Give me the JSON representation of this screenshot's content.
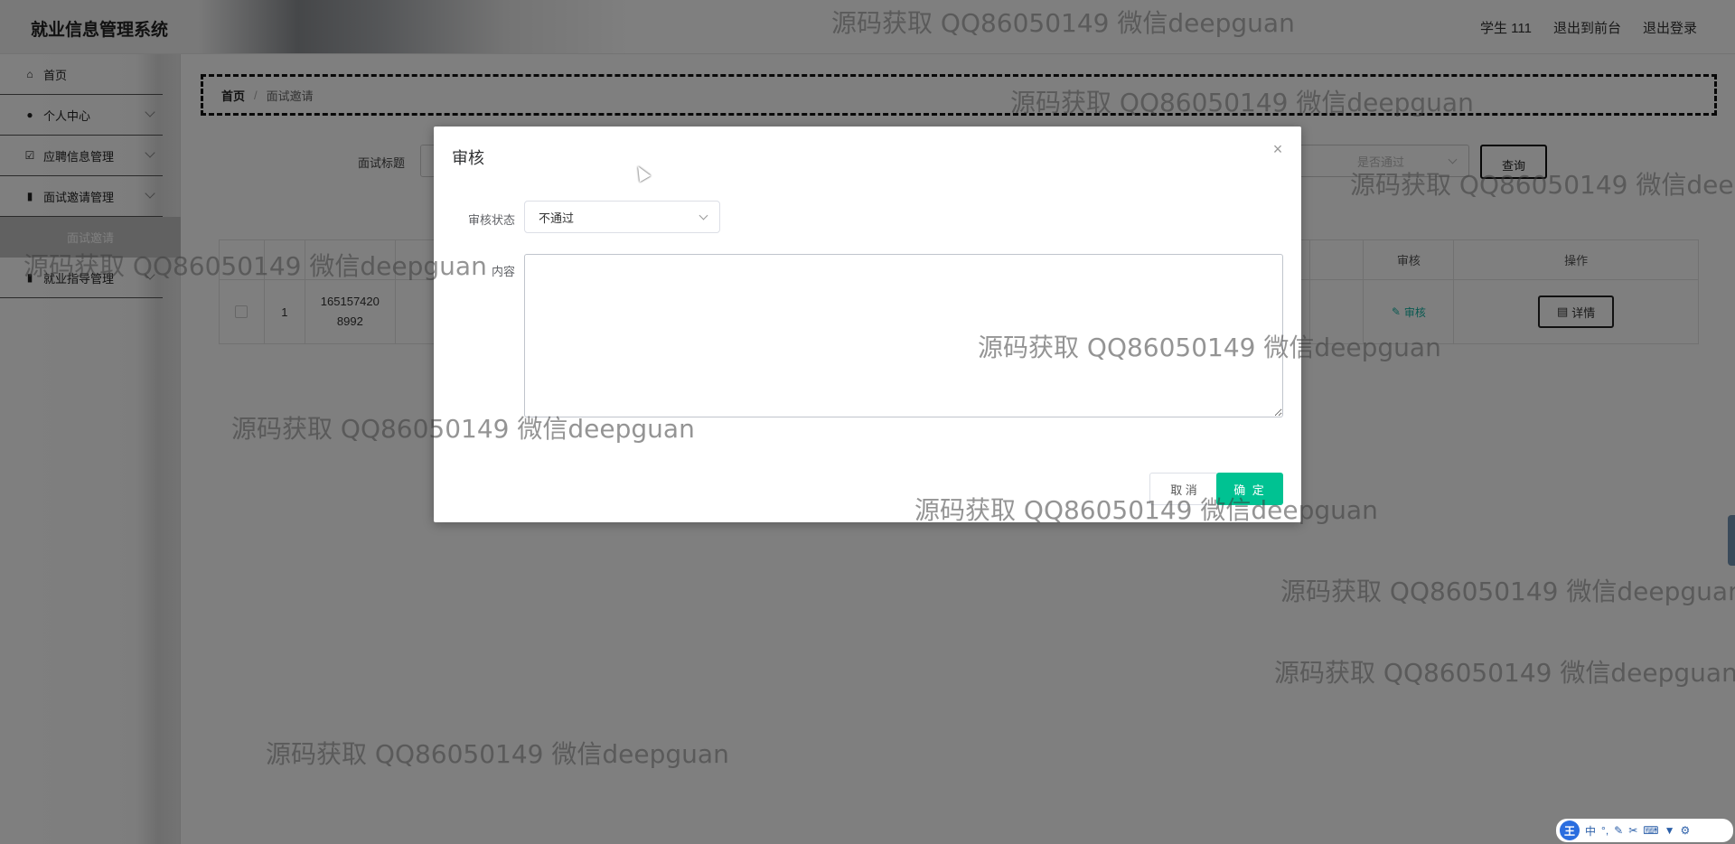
{
  "app": {
    "title": "就业信息管理系统",
    "user_label": "学生 111",
    "front_link": "退出到前台",
    "logout_link": "退出登录"
  },
  "sidebar": {
    "items": [
      {
        "label": "首页",
        "icon": "home-icon"
      },
      {
        "label": "个人中心",
        "icon": "user-icon"
      },
      {
        "label": "应聘信息管理",
        "icon": "checklist-icon"
      },
      {
        "label": "面试邀请管理",
        "icon": "chart-icon"
      },
      {
        "label": "就业指导管理",
        "icon": "chart-icon"
      }
    ],
    "active_sub": "面试邀请"
  },
  "breadcrumb": {
    "home": "首页",
    "separator": "/",
    "current": "面试邀请"
  },
  "filters": {
    "title_label": "面试标题",
    "status_placeholder": "是否通过",
    "query_button": "查询"
  },
  "table": {
    "headers": [
      "",
      "",
      "",
      "",
      "",
      "审核",
      "操作"
    ],
    "rows": [
      {
        "index": "1",
        "id": "1651574208992",
        "audit": "审核",
        "detail": "详情"
      }
    ]
  },
  "dialog": {
    "title": "审核",
    "status_label": "审核状态",
    "status_value": "不通过",
    "content_label": "内容",
    "content_value": "",
    "cancel": "取 消",
    "confirm": "确 定"
  },
  "watermark": "源码获取 QQ86050149 微信deepguan",
  "ime": {
    "logo": "王",
    "mode": "中"
  },
  "colors": {
    "accent": "#00c292",
    "audit_link": "#17b3a3",
    "overlay": "rgba(0,0,0,0.5)"
  }
}
